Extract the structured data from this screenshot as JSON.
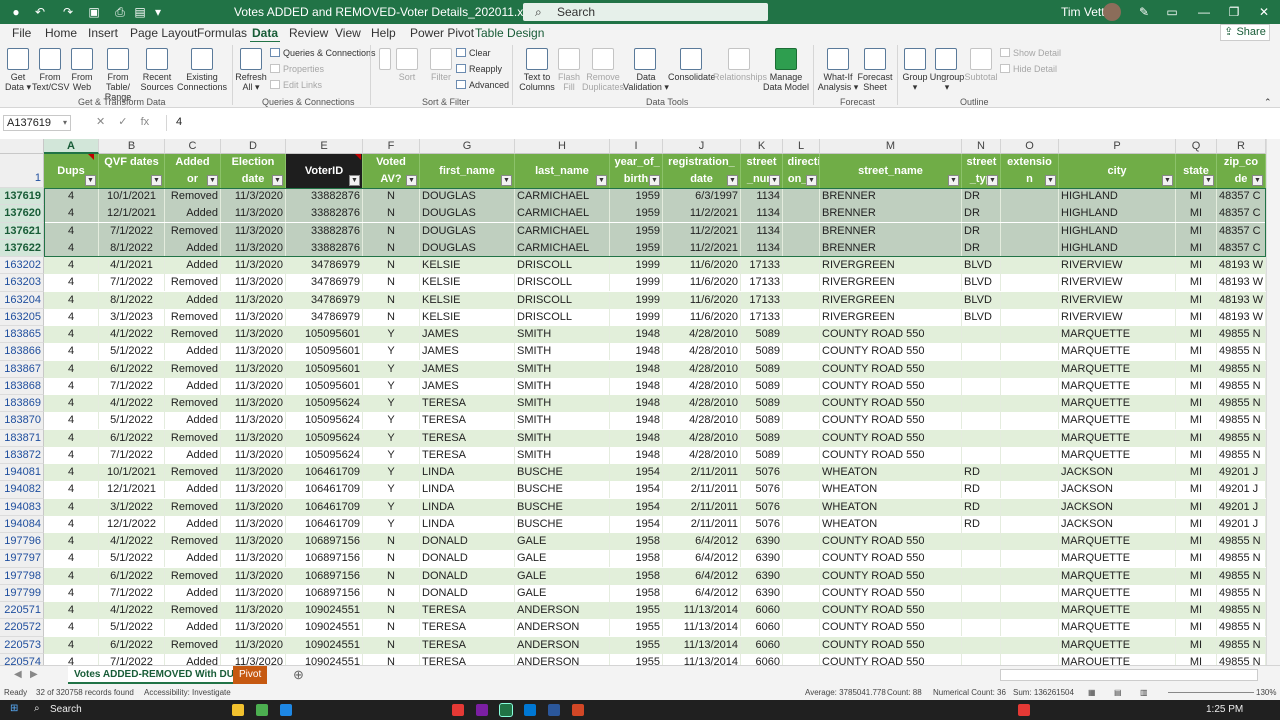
{
  "window": {
    "title": "Votes ADDED and REMOVED-Voter Details_202011.xlsx  -  Excel",
    "search_placeholder": "Search",
    "user": "Tim Vetter"
  },
  "menu": {
    "tabs": [
      "File",
      "Home",
      "Insert",
      "Page Layout",
      "Formulas",
      "Data",
      "Review",
      "View",
      "Help",
      "Power Pivot",
      "Table Design"
    ],
    "active": "Data",
    "share": "Share"
  },
  "ribbon": {
    "buttons": [
      {
        "label": "Get\nData ▾",
        "dim": false
      },
      {
        "label": "From\nText/CSV",
        "dim": false
      },
      {
        "label": "From\nWeb",
        "dim": false
      },
      {
        "label": "From Table/\nRange",
        "dim": false
      },
      {
        "label": "Recent\nSources",
        "dim": false
      },
      {
        "label": "Existing\nConnections",
        "dim": false
      },
      {
        "label": "Refresh\nAll ▾",
        "dim": false
      },
      {
        "label": "Sort",
        "dim": true
      },
      {
        "label": "Filter",
        "dim": true
      },
      {
        "label": "Text to\nColumns",
        "dim": false
      },
      {
        "label": "Flash\nFill",
        "dim": true
      },
      {
        "label": "Remove\nDuplicates",
        "dim": true
      },
      {
        "label": "Data\nValidation ▾",
        "dim": false
      },
      {
        "label": "Consolidate",
        "dim": false
      },
      {
        "label": "Relationships",
        "dim": true
      },
      {
        "label": "Manage\nData Model",
        "dim": false
      },
      {
        "label": "What-If\nAnalysis ▾",
        "dim": false
      },
      {
        "label": "Forecast\nSheet",
        "dim": false
      },
      {
        "label": "Group\n▾",
        "dim": false
      },
      {
        "label": "Ungroup\n▾",
        "dim": false
      },
      {
        "label": "Subtotal",
        "dim": true
      }
    ],
    "small": [
      {
        "label": "Queries & Connections",
        "dim": false
      },
      {
        "label": "Properties",
        "dim": true
      },
      {
        "label": "Edit Links",
        "dim": true
      },
      {
        "label": "Clear",
        "dim": false
      },
      {
        "label": "Reapply",
        "dim": false
      },
      {
        "label": "Advanced",
        "dim": false
      },
      {
        "label": "Show Detail",
        "dim": true
      },
      {
        "label": "Hide Detail",
        "dim": true
      }
    ],
    "groups": [
      "Get & Transform Data",
      "Queries & Connections",
      "Sort & Filter",
      "Data Tools",
      "Forecast",
      "Outline"
    ]
  },
  "formula_bar": {
    "name_box": "A137619",
    "value": "4"
  },
  "columns": [
    "A",
    "B",
    "C",
    "D",
    "E",
    "F",
    "G",
    "H",
    "I",
    "J",
    "K",
    "L",
    "M",
    "N",
    "O",
    "P",
    "Q",
    "R"
  ],
  "header_row_num": "1",
  "headers": [
    {
      "text": "Dups",
      "filter": "▼"
    },
    {
      "text": "QVF dates",
      "filter": "▼"
    },
    {
      "text": "Added or remove",
      "filter": "▼"
    },
    {
      "text": "Election date",
      "filter": "▼"
    },
    {
      "text": "VoterID",
      "filter": "▼"
    },
    {
      "text": "Voted AV?",
      "filter": "▼"
    },
    {
      "text": "first_name",
      "filter": "▼"
    },
    {
      "text": "last_name",
      "filter": "▼"
    },
    {
      "text": "year_of_ birth",
      "filter": "▼"
    },
    {
      "text": "registration_ date",
      "filter": "▼"
    },
    {
      "text": "street _num",
      "filter": "▼"
    },
    {
      "text": "directi on_p",
      "filter": "▼"
    },
    {
      "text": "street_name",
      "filter": "▼"
    },
    {
      "text": "street _typ",
      "filter": "▼"
    },
    {
      "text": "extensio n",
      "filter": "▼"
    },
    {
      "text": "city",
      "filter": "▼"
    },
    {
      "text": "state",
      "filter": "▼"
    },
    {
      "text": "zip_co de",
      "filter": "▼"
    }
  ],
  "rows": [
    {
      "n": "137619",
      "cells": [
        "4",
        "10/1/2021",
        "Removed",
        "11/3/2020",
        "33882876",
        "N",
        "DOUGLAS",
        "CARMICHAEL",
        "1959",
        "6/3/1997",
        "1134",
        "",
        "BRENNER",
        "DR",
        "",
        "HIGHLAND",
        "MI",
        "48357 C"
      ]
    },
    {
      "n": "137620",
      "cells": [
        "4",
        "12/1/2021",
        "Added",
        "11/3/2020",
        "33882876",
        "N",
        "DOUGLAS",
        "CARMICHAEL",
        "1959",
        "11/2/2021",
        "1134",
        "",
        "BRENNER",
        "DR",
        "",
        "HIGHLAND",
        "MI",
        "48357 C"
      ]
    },
    {
      "n": "137621",
      "cells": [
        "4",
        "7/1/2022",
        "Removed",
        "11/3/2020",
        "33882876",
        "N",
        "DOUGLAS",
        "CARMICHAEL",
        "1959",
        "11/2/2021",
        "1134",
        "",
        "BRENNER",
        "DR",
        "",
        "HIGHLAND",
        "MI",
        "48357 C"
      ]
    },
    {
      "n": "137622",
      "cells": [
        "4",
        "8/1/2022",
        "Added",
        "11/3/2020",
        "33882876",
        "N",
        "DOUGLAS",
        "CARMICHAEL",
        "1959",
        "11/2/2021",
        "1134",
        "",
        "BRENNER",
        "DR",
        "",
        "HIGHLAND",
        "MI",
        "48357 C"
      ]
    },
    {
      "n": "163202",
      "cells": [
        "4",
        "4/1/2021",
        "Added",
        "11/3/2020",
        "34786979",
        "N",
        "KELSIE",
        "DRISCOLL",
        "1999",
        "11/6/2020",
        "17133",
        "",
        "RIVERGREEN",
        "BLVD",
        "",
        "RIVERVIEW",
        "MI",
        "48193 W"
      ]
    },
    {
      "n": "163203",
      "cells": [
        "4",
        "7/1/2022",
        "Removed",
        "11/3/2020",
        "34786979",
        "N",
        "KELSIE",
        "DRISCOLL",
        "1999",
        "11/6/2020",
        "17133",
        "",
        "RIVERGREEN",
        "BLVD",
        "",
        "RIVERVIEW",
        "MI",
        "48193 W"
      ]
    },
    {
      "n": "163204",
      "cells": [
        "4",
        "8/1/2022",
        "Added",
        "11/3/2020",
        "34786979",
        "N",
        "KELSIE",
        "DRISCOLL",
        "1999",
        "11/6/2020",
        "17133",
        "",
        "RIVERGREEN",
        "BLVD",
        "",
        "RIVERVIEW",
        "MI",
        "48193 W"
      ]
    },
    {
      "n": "163205",
      "cells": [
        "4",
        "3/1/2023",
        "Removed",
        "11/3/2020",
        "34786979",
        "N",
        "KELSIE",
        "DRISCOLL",
        "1999",
        "11/6/2020",
        "17133",
        "",
        "RIVERGREEN",
        "BLVD",
        "",
        "RIVERVIEW",
        "MI",
        "48193 W"
      ]
    },
    {
      "n": "183865",
      "cells": [
        "4",
        "4/1/2022",
        "Removed",
        "11/3/2020",
        "105095601",
        "Y",
        "JAMES",
        "SMITH",
        "1948",
        "4/28/2010",
        "5089",
        "",
        "COUNTY ROAD 550",
        "",
        "",
        "MARQUETTE",
        "MI",
        "49855 N"
      ]
    },
    {
      "n": "183866",
      "cells": [
        "4",
        "5/1/2022",
        "Added",
        "11/3/2020",
        "105095601",
        "Y",
        "JAMES",
        "SMITH",
        "1948",
        "4/28/2010",
        "5089",
        "",
        "COUNTY ROAD 550",
        "",
        "",
        "MARQUETTE",
        "MI",
        "49855 N"
      ]
    },
    {
      "n": "183867",
      "cells": [
        "4",
        "6/1/2022",
        "Removed",
        "11/3/2020",
        "105095601",
        "Y",
        "JAMES",
        "SMITH",
        "1948",
        "4/28/2010",
        "5089",
        "",
        "COUNTY ROAD 550",
        "",
        "",
        "MARQUETTE",
        "MI",
        "49855 N"
      ]
    },
    {
      "n": "183868",
      "cells": [
        "4",
        "7/1/2022",
        "Added",
        "11/3/2020",
        "105095601",
        "Y",
        "JAMES",
        "SMITH",
        "1948",
        "4/28/2010",
        "5089",
        "",
        "COUNTY ROAD 550",
        "",
        "",
        "MARQUETTE",
        "MI",
        "49855 N"
      ]
    },
    {
      "n": "183869",
      "cells": [
        "4",
        "4/1/2022",
        "Removed",
        "11/3/2020",
        "105095624",
        "Y",
        "TERESA",
        "SMITH",
        "1948",
        "4/28/2010",
        "5089",
        "",
        "COUNTY ROAD 550",
        "",
        "",
        "MARQUETTE",
        "MI",
        "49855 N"
      ]
    },
    {
      "n": "183870",
      "cells": [
        "4",
        "5/1/2022",
        "Added",
        "11/3/2020",
        "105095624",
        "Y",
        "TERESA",
        "SMITH",
        "1948",
        "4/28/2010",
        "5089",
        "",
        "COUNTY ROAD 550",
        "",
        "",
        "MARQUETTE",
        "MI",
        "49855 N"
      ]
    },
    {
      "n": "183871",
      "cells": [
        "4",
        "6/1/2022",
        "Removed",
        "11/3/2020",
        "105095624",
        "Y",
        "TERESA",
        "SMITH",
        "1948",
        "4/28/2010",
        "5089",
        "",
        "COUNTY ROAD 550",
        "",
        "",
        "MARQUETTE",
        "MI",
        "49855 N"
      ]
    },
    {
      "n": "183872",
      "cells": [
        "4",
        "7/1/2022",
        "Added",
        "11/3/2020",
        "105095624",
        "Y",
        "TERESA",
        "SMITH",
        "1948",
        "4/28/2010",
        "5089",
        "",
        "COUNTY ROAD 550",
        "",
        "",
        "MARQUETTE",
        "MI",
        "49855 N"
      ]
    },
    {
      "n": "194081",
      "cells": [
        "4",
        "10/1/2021",
        "Removed",
        "11/3/2020",
        "106461709",
        "Y",
        "LINDA",
        "BUSCHE",
        "1954",
        "2/11/2011",
        "5076",
        "",
        "WHEATON",
        "RD",
        "",
        "JACKSON",
        "MI",
        "49201 J"
      ]
    },
    {
      "n": "194082",
      "cells": [
        "4",
        "12/1/2021",
        "Added",
        "11/3/2020",
        "106461709",
        "Y",
        "LINDA",
        "BUSCHE",
        "1954",
        "2/11/2011",
        "5076",
        "",
        "WHEATON",
        "RD",
        "",
        "JACKSON",
        "MI",
        "49201 J"
      ]
    },
    {
      "n": "194083",
      "cells": [
        "4",
        "3/1/2022",
        "Removed",
        "11/3/2020",
        "106461709",
        "Y",
        "LINDA",
        "BUSCHE",
        "1954",
        "2/11/2011",
        "5076",
        "",
        "WHEATON",
        "RD",
        "",
        "JACKSON",
        "MI",
        "49201 J"
      ]
    },
    {
      "n": "194084",
      "cells": [
        "4",
        "12/1/2022",
        "Added",
        "11/3/2020",
        "106461709",
        "Y",
        "LINDA",
        "BUSCHE",
        "1954",
        "2/11/2011",
        "5076",
        "",
        "WHEATON",
        "RD",
        "",
        "JACKSON",
        "MI",
        "49201 J"
      ]
    },
    {
      "n": "197796",
      "cells": [
        "4",
        "4/1/2022",
        "Removed",
        "11/3/2020",
        "106897156",
        "N",
        "DONALD",
        "GALE",
        "1958",
        "6/4/2012",
        "6390",
        "",
        "COUNTY ROAD 550",
        "",
        "",
        "MARQUETTE",
        "MI",
        "49855 N"
      ]
    },
    {
      "n": "197797",
      "cells": [
        "4",
        "5/1/2022",
        "Added",
        "11/3/2020",
        "106897156",
        "N",
        "DONALD",
        "GALE",
        "1958",
        "6/4/2012",
        "6390",
        "",
        "COUNTY ROAD 550",
        "",
        "",
        "MARQUETTE",
        "MI",
        "49855 N"
      ]
    },
    {
      "n": "197798",
      "cells": [
        "4",
        "6/1/2022",
        "Removed",
        "11/3/2020",
        "106897156",
        "N",
        "DONALD",
        "GALE",
        "1958",
        "6/4/2012",
        "6390",
        "",
        "COUNTY ROAD 550",
        "",
        "",
        "MARQUETTE",
        "MI",
        "49855 N"
      ]
    },
    {
      "n": "197799",
      "cells": [
        "4",
        "7/1/2022",
        "Added",
        "11/3/2020",
        "106897156",
        "N",
        "DONALD",
        "GALE",
        "1958",
        "6/4/2012",
        "6390",
        "",
        "COUNTY ROAD 550",
        "",
        "",
        "MARQUETTE",
        "MI",
        "49855 N"
      ]
    },
    {
      "n": "220571",
      "cells": [
        "4",
        "4/1/2022",
        "Removed",
        "11/3/2020",
        "109024551",
        "N",
        "TERESA",
        "ANDERSON",
        "1955",
        "11/13/2014",
        "6060",
        "",
        "COUNTY ROAD 550",
        "",
        "",
        "MARQUETTE",
        "MI",
        "49855 N"
      ]
    },
    {
      "n": "220572",
      "cells": [
        "4",
        "5/1/2022",
        "Added",
        "11/3/2020",
        "109024551",
        "N",
        "TERESA",
        "ANDERSON",
        "1955",
        "11/13/2014",
        "6060",
        "",
        "COUNTY ROAD 550",
        "",
        "",
        "MARQUETTE",
        "MI",
        "49855 N"
      ]
    },
    {
      "n": "220573",
      "cells": [
        "4",
        "6/1/2022",
        "Removed",
        "11/3/2020",
        "109024551",
        "N",
        "TERESA",
        "ANDERSON",
        "1955",
        "11/13/2014",
        "6060",
        "",
        "COUNTY ROAD 550",
        "",
        "",
        "MARQUETTE",
        "MI",
        "49855 N"
      ]
    },
    {
      "n": "220574",
      "cells": [
        "4",
        "7/1/2022",
        "Added",
        "11/3/2020",
        "109024551",
        "N",
        "TERESA",
        "ANDERSON",
        "1955",
        "11/13/2014",
        "6060",
        "",
        "COUNTY ROAD 550",
        "",
        "",
        "MARQUETTE",
        "MI",
        "49855 N"
      ]
    }
  ],
  "sheets": {
    "active": "Votes ADDED-REMOVED With DUPS",
    "other": "Pivot"
  },
  "status": {
    "ready": "Ready",
    "records": "32 of 320758 records found",
    "accessibility": "Accessibility: Investigate",
    "average": "Average: 3785041.778",
    "count": "Count: 88",
    "numerical_count": "Numerical Count: 36",
    "sum": "Sum: 136261504",
    "zoom": "130%"
  },
  "taskbar": {
    "search": "Search",
    "time": "1:25 PM"
  },
  "colors": {
    "excel_green": "#217346",
    "header_green": "#70ad47",
    "band_light": "#e2efda",
    "selected_rows": "#bfcfbf",
    "tab_pivot": "#c65911"
  }
}
